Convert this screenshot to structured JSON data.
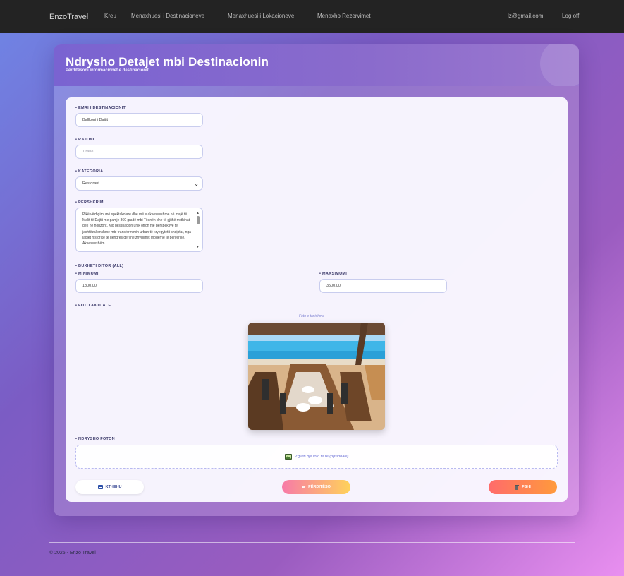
{
  "navbar": {
    "brand": "EnzoTravel",
    "links": [
      "Kreu",
      "Menaxhuesi i Destinacioneve",
      "Menaxhuesi i Lokacioneve",
      "Menaxho Rezervimet"
    ],
    "user_email": "lz@gmail.com",
    "logoff": "Log off"
  },
  "header": {
    "title": "Ndrysho Detajet mbi Destinacionin",
    "subtitle": "Përditësoni informacionet e destinacionit"
  },
  "form": {
    "name_label": "• EMRI I DESTINACIONIT",
    "name_value": "Ballkoni i Dajtit",
    "region_label": "• RAJONI",
    "region_placeholder": "Tirane",
    "category_label": "• KATEGORIA",
    "category_value": "Restorant",
    "description_label": "• PERSHKRIMI",
    "description_value": "Pikë vëzhgimi më spektakolare dhe më e aksesueshme në majë të Malit të Dajtit me pamje 360 gradë mbi Tiranën dhe të gjithë rrethinat deri në horizont. Kjo destinacion unik ofron një perspektivë të jashtëzakonshme mbi transformimin urban të kryeqytetit shqiptar, nga lagjet historike të qendrës deri në zhvillimet moderne të periferisë. Aksesueshëm",
    "budget_label": "• BUXHETI DITOR (ALL)",
    "min_label": "• MINIMUMI",
    "min_value": "1800.00",
    "max_label": "• MAKSIMUMI",
    "max_value": "3500.00",
    "photo_label": "• FOTO AKTUALE",
    "photo_caption": "Foto e tanishme",
    "change_photo_label": "• NDRYSHO FOTON",
    "upload_text": "Zgjidh një foto të re (opsionale)"
  },
  "buttons": {
    "back": "KTHEHU",
    "update": "PËRDITËSO",
    "delete": "FSHI"
  },
  "footer": {
    "text": "© 2025 - Enzo Travel"
  },
  "icons": {
    "back": "back-book-icon",
    "update": "pencil-icon",
    "delete": "trash-icon",
    "upload": "image-icon"
  }
}
